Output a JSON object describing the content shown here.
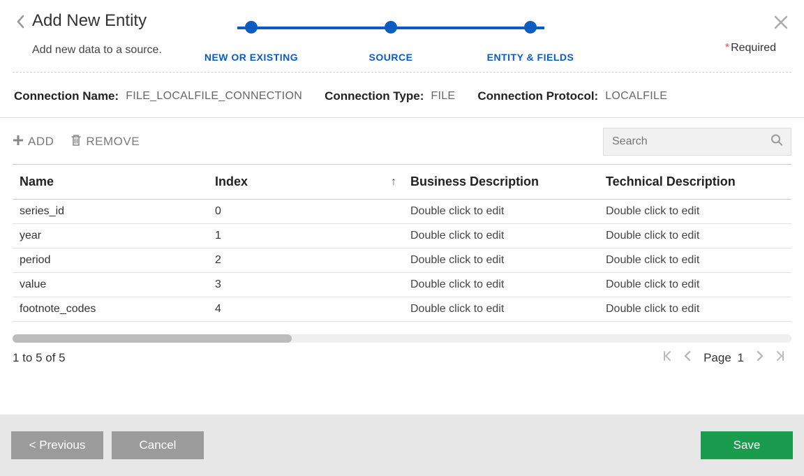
{
  "header": {
    "title": "Add New Entity",
    "subtitle": "Add new data to a source.",
    "required_label": "Required"
  },
  "stepper": {
    "steps": [
      {
        "label": "NEW OR EXISTING"
      },
      {
        "label": "SOURCE"
      },
      {
        "label": "ENTITY & FIELDS"
      }
    ]
  },
  "connection": {
    "name_label": "Connection Name:",
    "name_value": "FILE_LOCALFILE_CONNECTION",
    "type_label": "Connection Type:",
    "type_value": "FILE",
    "protocol_label": "Connection Protocol:",
    "protocol_value": "LOCALFILE"
  },
  "toolbar": {
    "add_label": "ADD",
    "remove_label": "REMOVE",
    "search_placeholder": "Search"
  },
  "table": {
    "headers": {
      "name": "Name",
      "index": "Index",
      "bdesc": "Business Description",
      "tdesc": "Technical Description"
    },
    "rows": [
      {
        "name": "series_id",
        "index": "0",
        "bdesc": "Double click to edit",
        "tdesc": "Double click to edit"
      },
      {
        "name": "year",
        "index": "1",
        "bdesc": "Double click to edit",
        "tdesc": "Double click to edit"
      },
      {
        "name": "period",
        "index": "2",
        "bdesc": "Double click to edit",
        "tdesc": "Double click to edit"
      },
      {
        "name": "value",
        "index": "3",
        "bdesc": "Double click to edit",
        "tdesc": "Double click to edit"
      },
      {
        "name": "footnote_codes",
        "index": "4",
        "bdesc": "Double click to edit",
        "tdesc": "Double click to edit"
      }
    ]
  },
  "pager": {
    "range_text": "1 to 5 of 5",
    "page_label": "Page",
    "page_number": "1"
  },
  "footer": {
    "previous_label": "< Previous",
    "cancel_label": "Cancel",
    "save_label": "Save"
  }
}
